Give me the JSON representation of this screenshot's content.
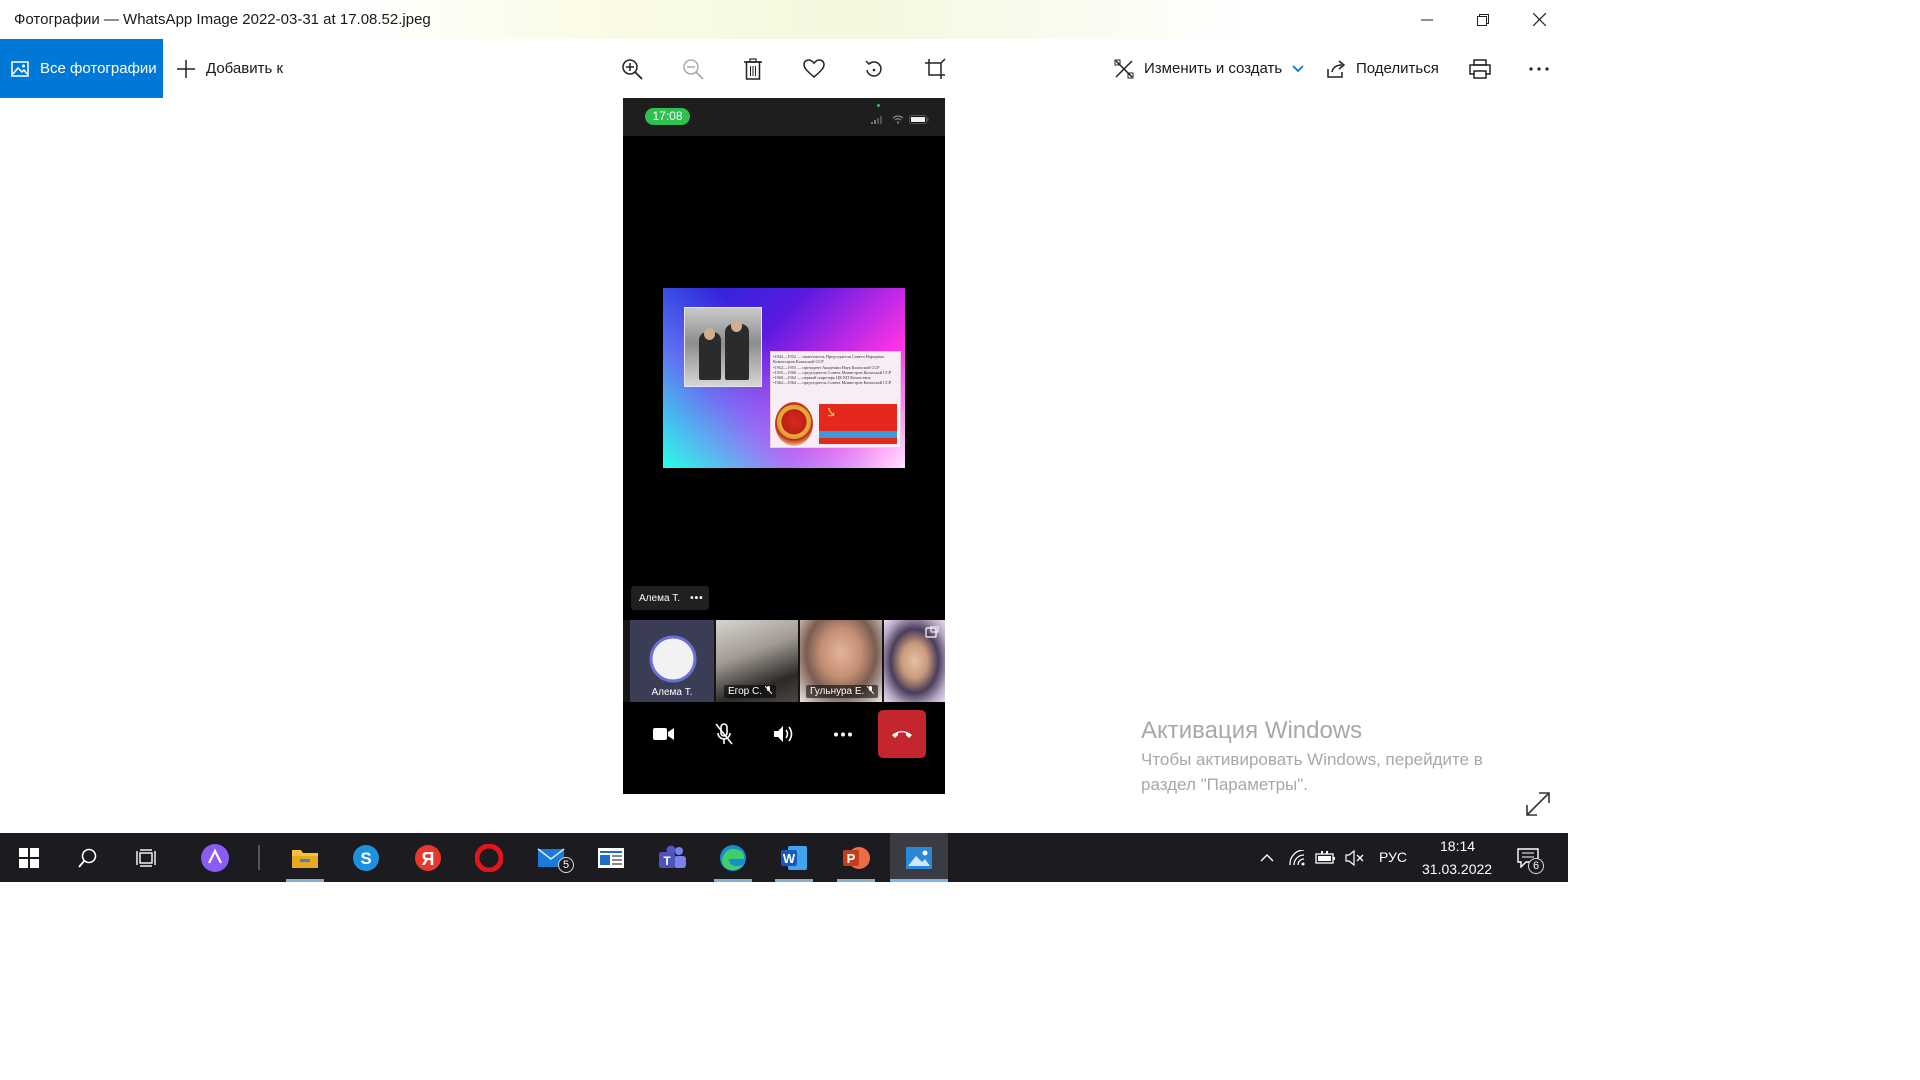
{
  "window": {
    "title": "Фотографии — WhatsApp Image 2022-03-31 at 17.08.52.jpeg"
  },
  "toolbar": {
    "all_photos_label": "Все фотографии",
    "add_to_label": "Добавить к",
    "edit_create_label": "Изменить и создать",
    "share_label": "Поделиться"
  },
  "phone": {
    "time": "17:08",
    "slide_lines": [
      "•1942—1952 — заместитель Председателя Совета Народных Комиссаров Казахской ССР",
      "•1952—1955 — президент Академии Наук Казахской ССР",
      "•1955—1960 — председатель Совета Министров Казахской ССР",
      "•1960—1962 — первый секретарь ЦК КП Казахстана",
      "•1962—1964 — председатель Совета Министров Казахской ССР"
    ],
    "speaker_chip": "Алема Т.",
    "speaker_more": "•••",
    "participants": [
      {
        "name": "Алема Т."
      },
      {
        "name": "Егор С."
      },
      {
        "name": "Гульнура Е."
      },
      {
        "name": ""
      }
    ]
  },
  "activation": {
    "title": "Активация Windows",
    "body": "Чтобы активировать Windows, перейдите в раздел \"Параметры\"."
  },
  "taskbar": {
    "language": "РУС",
    "time": "18:14",
    "date": "31.03.2022",
    "mail_badge": "5",
    "notification_badge": "6"
  },
  "colors": {
    "accent": "#0078d7",
    "hangup": "#c4262e",
    "time_pill": "#30c04f",
    "taskbar": "#1b1b20"
  }
}
